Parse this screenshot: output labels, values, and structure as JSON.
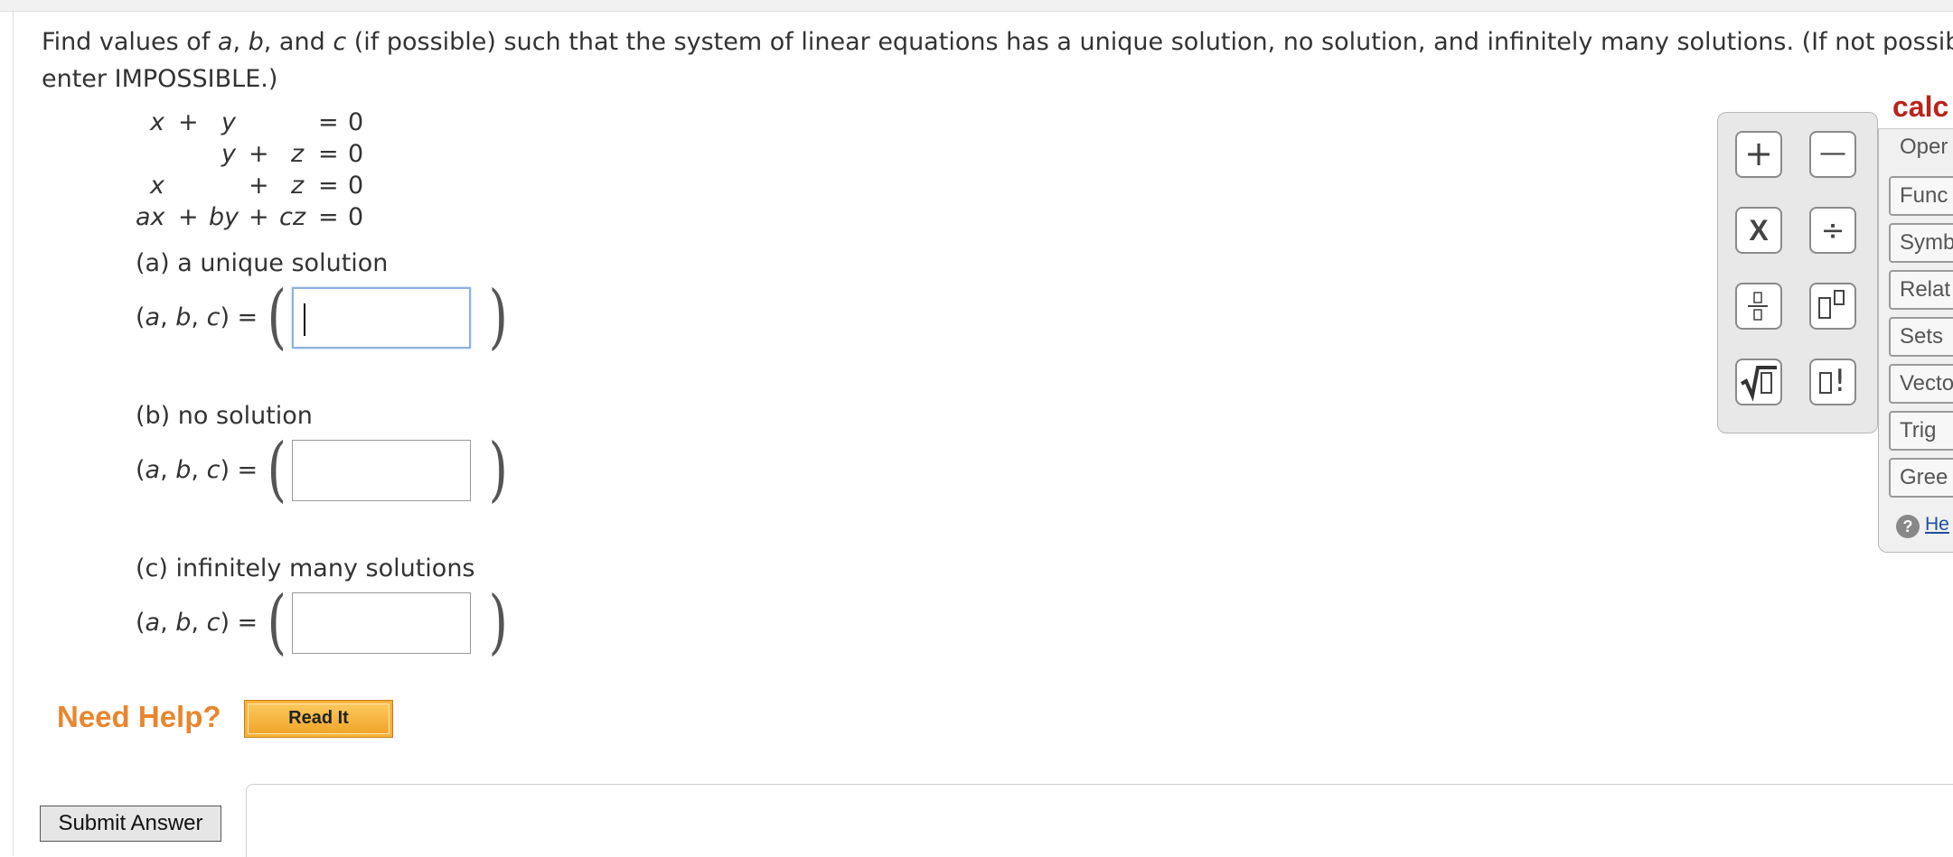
{
  "prompt": {
    "line1_a": "Find values of ",
    "var_a": "a",
    "comma1": ", ",
    "var_b": "b",
    "and_text": ", and ",
    "var_c": "c",
    "line1_rest": " (if possible) such that the system of linear equations has a unique solution, no solution, and infinitely many solutions. (If not possible,",
    "line2": "enter IMPOSSIBLE.)"
  },
  "equations": [
    {
      "x": "x",
      "op1": "+",
      "y": "y",
      "op2": "",
      "z": "",
      "eq": "=",
      "rhs": "0"
    },
    {
      "x": "",
      "op1": "",
      "y": "y",
      "op2": "+",
      "z": "z",
      "eq": "=",
      "rhs": "0"
    },
    {
      "x": "x",
      "op1": "",
      "y": "",
      "op2": "+",
      "z": "z",
      "eq": "=",
      "rhs": "0"
    },
    {
      "x": "ax",
      "op1": "+",
      "y": "by",
      "op2": "+",
      "z": "cz",
      "eq": "=",
      "rhs": "0"
    }
  ],
  "parts": [
    {
      "label": "(a) a unique solution",
      "value": ""
    },
    {
      "label": "(b) no solution",
      "value": ""
    },
    {
      "label": "(c) infinitely many solutions",
      "value": ""
    }
  ],
  "abc": {
    "open": "(",
    "a": "a",
    "sep1": ", ",
    "b": "b",
    "sep2": ", ",
    "c": "c",
    "close": ") ="
  },
  "paren_left": "(",
  "paren_right": ")",
  "help": {
    "need_help": "Need Help?",
    "read_it": "Read It"
  },
  "submit_label": "Submit Answer",
  "palette": {
    "plus": "+",
    "minus": "—",
    "times": "X",
    "divide": "÷",
    "factorial": "!"
  },
  "calculator": {
    "title": "calc",
    "items": [
      "Oper",
      "Func",
      "Symb",
      "Relat",
      "Sets",
      "Vecto",
      "Trig",
      "Gree"
    ],
    "help": "He"
  }
}
